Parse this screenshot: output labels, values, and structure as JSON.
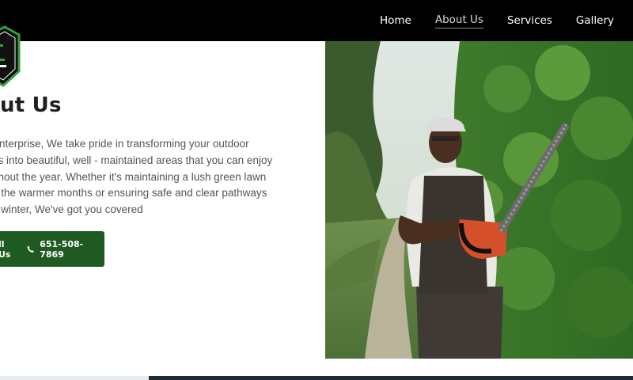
{
  "nav": {
    "items": [
      {
        "label": "Home",
        "active": false
      },
      {
        "label": "About Us",
        "active": true
      },
      {
        "label": "Services",
        "active": false
      },
      {
        "label": "Gallery",
        "active": false
      }
    ]
  },
  "about": {
    "heading": "out Us",
    "lines": [
      " Enterprise, We take pride in transforming your outdoor",
      "es into beautiful, well - maintained areas that you can enjoy",
      "ghout the year. Whether it's maintaining a lush green lawn",
      "g the warmer months or ensuring safe and clear pathways",
      "g winter, We've got you covered"
    ]
  },
  "cta": {
    "label": "ll Us",
    "phone": "651-508-7869"
  },
  "colors": {
    "topbar": "#000000",
    "cta_bg": "#1f5a22",
    "logo_green": "#2ea33a"
  },
  "icons": {
    "phone": "phone-icon",
    "logo": "shield-logo-icon"
  }
}
